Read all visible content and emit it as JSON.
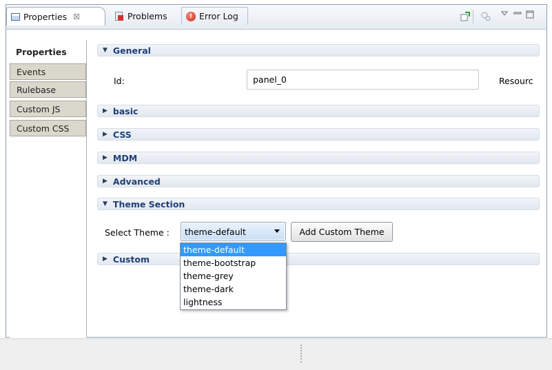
{
  "tabs": {
    "properties": "Properties",
    "problems": "Problems",
    "error_log": "Error Log",
    "close_glyph": "☒"
  },
  "toolbar_icons": [
    "new-view-icon",
    "pin-icon",
    "view-menu-icon",
    "minimize-icon",
    "maximize-icon"
  ],
  "side_tabs": [
    "Properties",
    "Events",
    "Rulebase",
    "Custom JS",
    "Custom CSS"
  ],
  "sections": {
    "general": "General",
    "basic": "basic",
    "css": "CSS",
    "mdm": "MDM",
    "advanced": "Advanced",
    "theme": "Theme Section",
    "custom": "Custom"
  },
  "general": {
    "id_label": "Id:",
    "id_value": "panel_0",
    "resource_label": "Resourc"
  },
  "theme": {
    "select_label": "Select Theme :",
    "selected": "theme-default",
    "add_button": "Add Custom Theme",
    "options": [
      "theme-default",
      "theme-bootstrap",
      "theme-grey",
      "theme-dark",
      "lightness"
    ]
  },
  "colors": {
    "section_text": "#1f3f76",
    "selection": "#3399ff",
    "side_tab_bg": "#dad8cc"
  }
}
